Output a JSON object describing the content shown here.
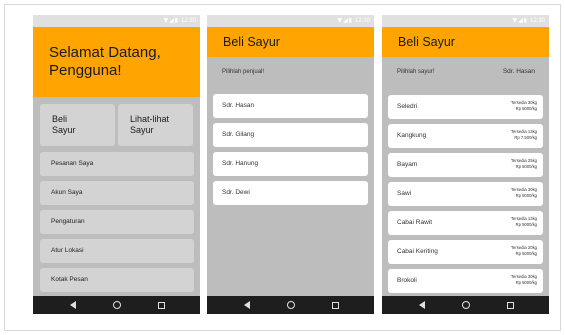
{
  "status_bar": {
    "icons": "▼◢▮",
    "time": "12:30"
  },
  "screen_welcome": {
    "title_line1": "Selamat Datang,",
    "title_line2": "Pengguna!",
    "tiles": [
      {
        "line1": "Beli",
        "line2": "Sayur"
      },
      {
        "line1": "Lihat-lihat",
        "line2": "Sayur"
      }
    ],
    "menu": [
      {
        "label": "Pesanan Saya"
      },
      {
        "label": "Akun Saya"
      },
      {
        "label": "Pengaturan"
      },
      {
        "label": "Atur Lokasi"
      },
      {
        "label": "Kotak Pesan"
      }
    ]
  },
  "screen_sellers": {
    "title": "Beli Sayur",
    "subheader": "Pilihlah penjual!",
    "sellers": [
      {
        "name": "Sdr. Hasan"
      },
      {
        "name": "Sdr. Gilang"
      },
      {
        "name": "Sdr. Hanung"
      },
      {
        "name": "Sdr. Dewi"
      }
    ]
  },
  "screen_vegetables": {
    "title": "Beli Sayur",
    "subheader": "Pilihlah sayur!",
    "seller_name": "Sdr. Hasan",
    "items": [
      {
        "name": "Seledri",
        "stock": "Tersedia 30kg",
        "price": "Rp 5000/kg"
      },
      {
        "name": "Kangkung",
        "stock": "Tersedia 13kg",
        "price": "Rp 7.500/kg"
      },
      {
        "name": "Bayam",
        "stock": "Tersedia 25kg",
        "price": "Rp 5000/kg"
      },
      {
        "name": "Sawi",
        "stock": "Tersedia 30kg",
        "price": "Rp 5000/kg"
      },
      {
        "name": "Cabai Rawit",
        "stock": "Tersedia 13kg",
        "price": "Rp 5000/kg"
      },
      {
        "name": "Cabai Keriting",
        "stock": "Tersedia 20kg",
        "price": "Rp 5000/kg"
      },
      {
        "name": "Brokoli",
        "stock": "Tersedia 30kg",
        "price": "Rp 5000/kg"
      }
    ]
  },
  "colors": {
    "app_bar": "#ffa400",
    "screen_background": "#bdbdbd",
    "tile": "#d3d3d3",
    "nav_bar": "#1e1e1e"
  },
  "nav_icons": [
    "back-icon",
    "home-icon",
    "recent-apps-icon"
  ]
}
